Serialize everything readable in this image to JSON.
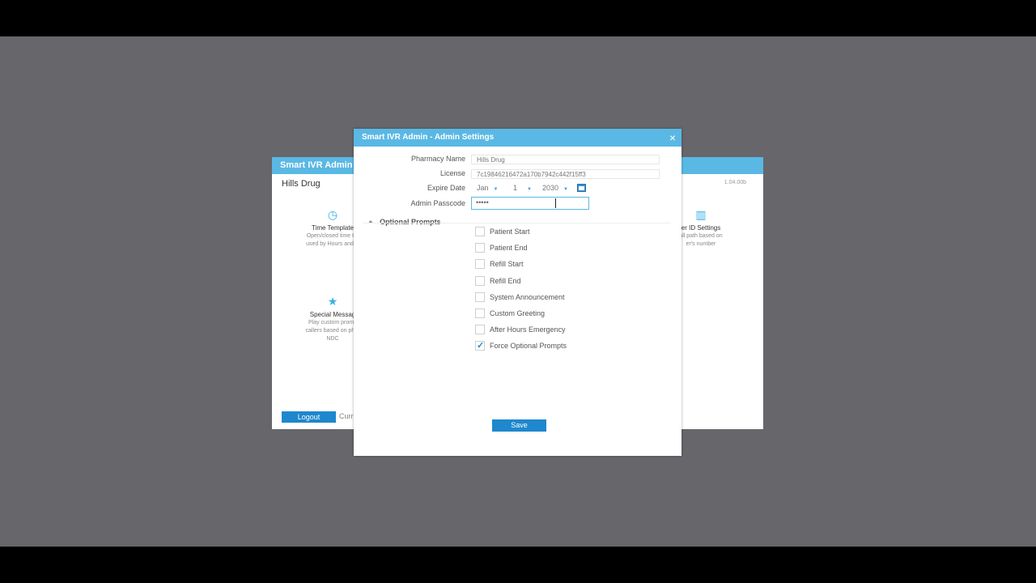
{
  "background_window": {
    "title": "Smart IVR Admin",
    "pharmacy": "Hills Drug",
    "version": "1.04.00b",
    "tiles": [
      {
        "icon": "clock-icon",
        "title": "Time Template",
        "desc1": "Open/closed time ter",
        "desc2": "used by Hours and H"
      },
      {
        "icon": "star-icon",
        "title": "Special Messag",
        "desc1": "Play custom promp",
        "desc2": "callers based on phor",
        "desc3": "NDC"
      },
      {
        "icon": "caller-id-icon",
        "title": "er ID Settings",
        "desc1": "all path based on",
        "desc2": "er's number"
      }
    ],
    "logout_label": "Logout",
    "current_label": "Curr"
  },
  "dialog": {
    "title": "Smart IVR Admin - Admin Settings",
    "close_label": "×",
    "fields": {
      "pharmacy_name_label": "Pharmacy Name",
      "pharmacy_name_value": "Hills Drug",
      "license_label": "License",
      "license_value": "7c19846216472a170b7942c442f15ff3",
      "expire_label": "Expire Date",
      "expire_month": "Jan",
      "expire_day": "1",
      "expire_year": "2030",
      "passcode_label": "Admin Passcode",
      "passcode_value": "•••••"
    },
    "optional": {
      "toggle": "⏶",
      "label": "Optional Prompts",
      "prompts": [
        {
          "label": "Patient Start",
          "checked": false
        },
        {
          "label": "Patient End",
          "checked": false
        },
        {
          "label": "Refill Start",
          "checked": false
        },
        {
          "label": "Refill End",
          "checked": false
        },
        {
          "label": "System Announcement",
          "checked": false
        },
        {
          "label": "Custom Greeting",
          "checked": false
        },
        {
          "label": "After Hours Emergency",
          "checked": false
        },
        {
          "label": "Force Optional Prompts",
          "checked": true
        }
      ]
    },
    "save_label": "Save"
  },
  "colors": {
    "accent": "#5ab8e4",
    "button": "#1e87cd",
    "backdrop": "#67666b"
  }
}
